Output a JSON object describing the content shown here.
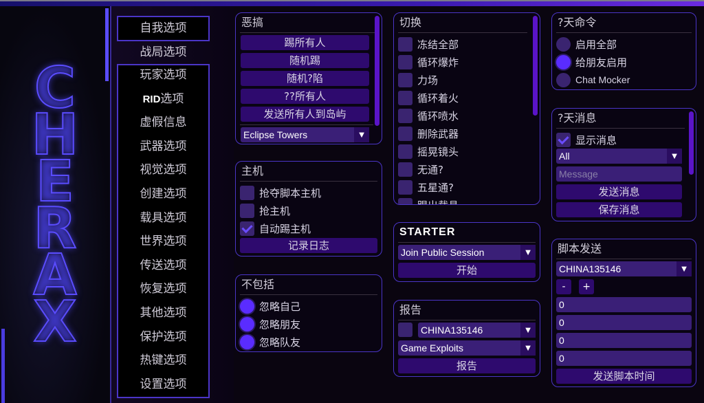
{
  "logo": {
    "text": [
      "C",
      "H",
      "E",
      "R",
      "A",
      "X"
    ]
  },
  "nav": {
    "items": [
      "自我选项",
      "战局选项",
      "玩家选项",
      "RID选项",
      "虚假信息",
      "武器选项",
      "视觉选项",
      "创建选项",
      "载具选项",
      "世界选项",
      "传送选项",
      "恢复选项",
      "其他选项",
      "保护选项",
      "热键选项",
      "设置选项"
    ],
    "rid_prefix": "RID",
    "rid_suffix": "选项"
  },
  "troll": {
    "title": "恶搞",
    "buttons": [
      "踢所有人",
      "随机踢",
      "随机?陷",
      "??所有人",
      "发送所有人到岛屿"
    ],
    "location": "Eclipse Towers"
  },
  "host": {
    "title": "主机",
    "options": [
      {
        "label": "抢夺脚本主机",
        "checked": false
      },
      {
        "label": "抢主机",
        "checked": false
      },
      {
        "label": "自动踢主机",
        "checked": true
      }
    ],
    "log_button": "记录日志"
  },
  "exclude": {
    "title": "不包括",
    "options": [
      {
        "label": "忽略自己",
        "on": true
      },
      {
        "label": "忽略朋友",
        "on": true
      },
      {
        "label": "忽略队友",
        "on": true
      }
    ]
  },
  "toggles": {
    "title": "切换",
    "items": [
      "冻结全部",
      "循环爆炸",
      "力场",
      "循环着火",
      "循环喷水",
      "删除武器",
      "摇晃镜头",
      "无通?",
      "五星通?",
      "踢出载具"
    ]
  },
  "starter": {
    "title": "STARTER",
    "session": "Join Public Session",
    "start_button": "开始"
  },
  "report": {
    "title": "报告",
    "player": "CHINA135146",
    "reason": "Game Exploits",
    "report_button": "报告"
  },
  "chat_cmd": {
    "title": "?天命令",
    "options": [
      {
        "label": "启用全部",
        "on": false
      },
      {
        "label": "给朋友启用",
        "on": true
      },
      {
        "label": "Chat Mocker",
        "on": false
      }
    ]
  },
  "chat_msg": {
    "title": "?天消息",
    "show_label": "显示消息",
    "show_checked": true,
    "target": "All",
    "message_placeholder": "Message",
    "send_button": "发送消息",
    "save_button": "保存消息"
  },
  "script_send": {
    "title": "脚本发送",
    "player": "CHINA135146",
    "minus": "-",
    "plus": "+",
    "values": [
      "0",
      "0",
      "0",
      "0"
    ],
    "send_button": "发送脚本时间"
  },
  "colors": {
    "accent": "#4b35c8",
    "button": "#2e0a6e",
    "active": "#5a2cff"
  }
}
